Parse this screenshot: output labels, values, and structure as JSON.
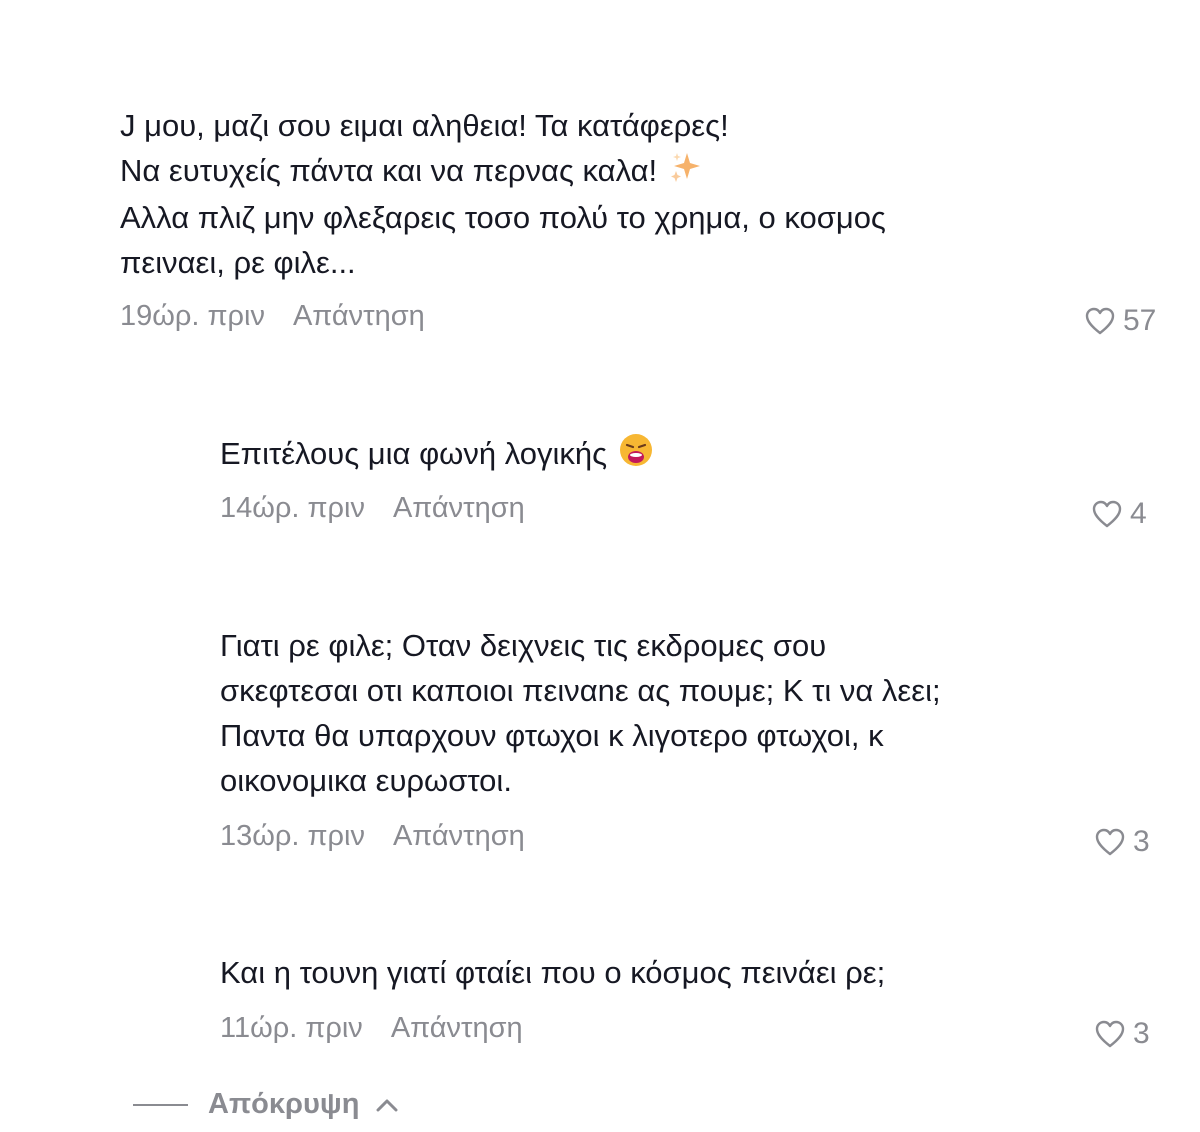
{
  "comments": [
    {
      "lines": [
        "J μου, μαζι σου ειμαι αληθεια! Τα κατάφερες!",
        "Να ευτυχείς πάντα και να περνας καλα!",
        "Αλλα πλιζ μην φλεξαρεις τοσο πολύ το χρημα, ο κοσμος",
        "πειναει, ρε φιλε..."
      ],
      "emoji": "sparkles-emoji",
      "time": "19ώρ. πριν",
      "reply_label": "Απάντηση",
      "likes": "57"
    },
    {
      "lines": [
        "Επιτέλους μια φωνή λογικής"
      ],
      "emoji": "weary-face-emoji",
      "time": "14ώρ. πριν",
      "reply_label": "Απάντηση",
      "likes": "4"
    },
    {
      "lines": [
        "Γιατι ρε φιλε; Οταν δειχνεις τις εκδρομες σου",
        "σκεφτεσαι οτι καποιοι πειναnε ας πουμε; Κ τι να λεει;",
        "Παντα θα υπαρχουν φτωχοι κ λιγοτερο φτωχοι, κ",
        "οικονομικα ευρωστοι."
      ],
      "time": "13ώρ. πριν",
      "reply_label": "Απάντηση",
      "likes": "3"
    },
    {
      "lines": [
        "Και η τουνη γιατί φταίει που ο κόσμος πεινάει ρε;"
      ],
      "time": "11ώρ. πριν",
      "reply_label": "Απάντηση",
      "likes": "3"
    }
  ],
  "hide_label": "Απόκρυψη",
  "colors": {
    "text": "#161823",
    "muted": "#8a8b91",
    "background": "#ffffff"
  },
  "icons": [
    "heart-outline-icon",
    "chevron-up-icon"
  ]
}
